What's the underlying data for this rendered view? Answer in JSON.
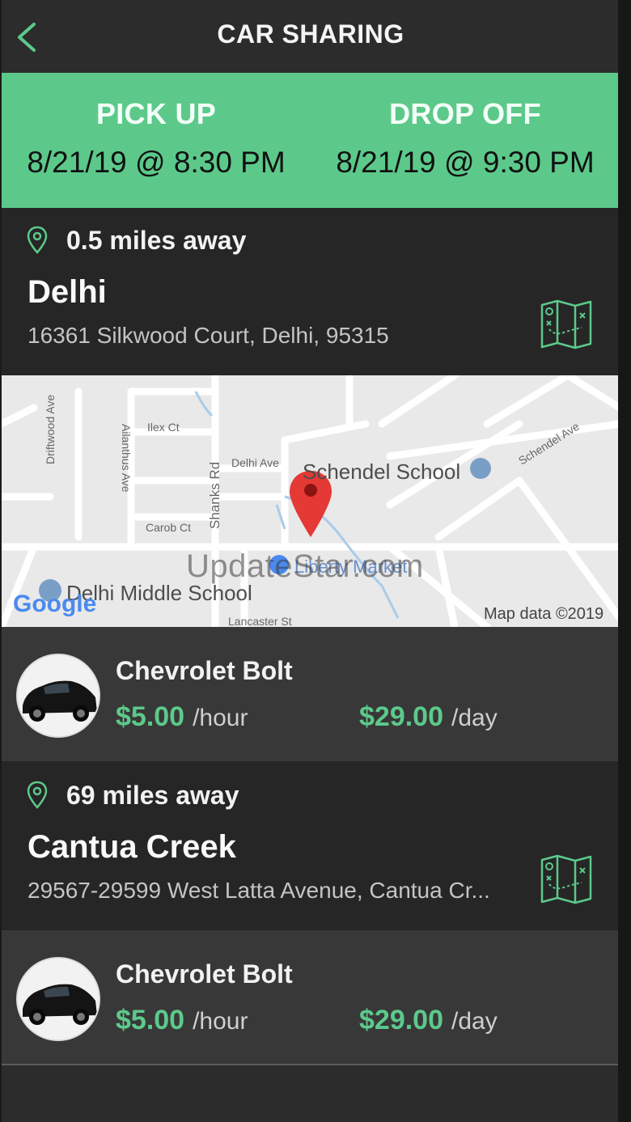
{
  "header": {
    "title": "CAR SHARING"
  },
  "booking": {
    "pickup_label": "PICK UP",
    "pickup_time": "8/21/19 @ 8:30 PM",
    "dropoff_label": "DROP OFF",
    "dropoff_time": "8/21/19 @ 9:30 PM"
  },
  "locations": [
    {
      "distance": "0.5 miles away",
      "city": "Delhi",
      "address": "16361 Silkwood Court, Delhi, 95315"
    },
    {
      "distance": "69 miles away",
      "city": "Cantua Creek",
      "address": "29567-29599 West Latta Avenue, Cantua Cr..."
    }
  ],
  "map": {
    "labels": [
      "Driftwood Ave",
      "Ailanthus Ave",
      "Ilex Ct",
      "Shanks Rd",
      "Delhi Ave",
      "Carob Ct",
      "Schendel Ave",
      "Lancaster St"
    ],
    "school": "Schendel School",
    "middle_school": "Delhi Middle School",
    "market": "Liberty Market",
    "logo": "Google",
    "copyright": "Map data ©2019"
  },
  "cars": [
    {
      "name": "Chevrolet Bolt",
      "hour_price": "$5.00",
      "hour_unit": "/hour",
      "day_price": "$29.00",
      "day_unit": "/day"
    },
    {
      "name": "Chevrolet Bolt",
      "hour_price": "$5.00",
      "hour_unit": "/hour",
      "day_price": "$29.00",
      "day_unit": "/day"
    }
  ],
  "watermark": "UpdateStar.com",
  "colors": {
    "accent": "#5cc98b",
    "background": "#2c2c2c",
    "section": "#262626",
    "car_row": "#383838"
  }
}
